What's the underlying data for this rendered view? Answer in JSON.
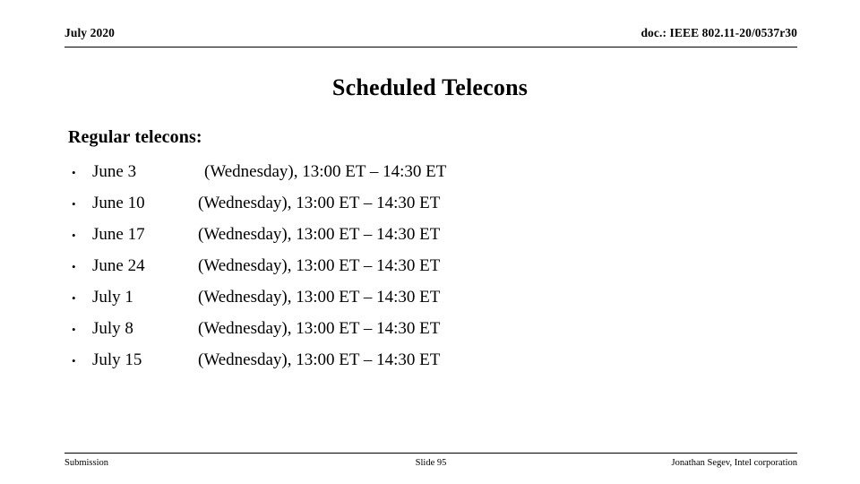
{
  "header": {
    "left_text": "July 2020",
    "right_text": "doc.: IEEE 802.11-20/0537r30"
  },
  "title": "Scheduled Telecons",
  "body": {
    "heading": "Regular telecons:",
    "bullet_glyph": "•",
    "rows": [
      {
        "date": "June 3",
        "detail": "(Wednesday), 13:00 ET – 14:30 ET"
      },
      {
        "date": "June 10",
        "detail": "(Wednesday), 13:00 ET – 14:30 ET"
      },
      {
        "date": "June 17",
        "detail": "(Wednesday), 13:00 ET – 14:30 ET"
      },
      {
        "date": "June 24",
        "detail": "(Wednesday), 13:00 ET – 14:30 ET"
      },
      {
        "date": "July 1",
        "detail": "(Wednesday), 13:00 ET – 14:30 ET"
      },
      {
        "date": "July 8",
        "detail": "(Wednesday), 13:00 ET – 14:30 ET"
      },
      {
        "date": "July 15",
        "detail": "(Wednesday), 13:00 ET – 14:30 ET"
      }
    ]
  },
  "footer": {
    "left_text": "Submission",
    "center_text": "Slide 95",
    "right_text": "Jonathan Segev, Intel corporation"
  }
}
